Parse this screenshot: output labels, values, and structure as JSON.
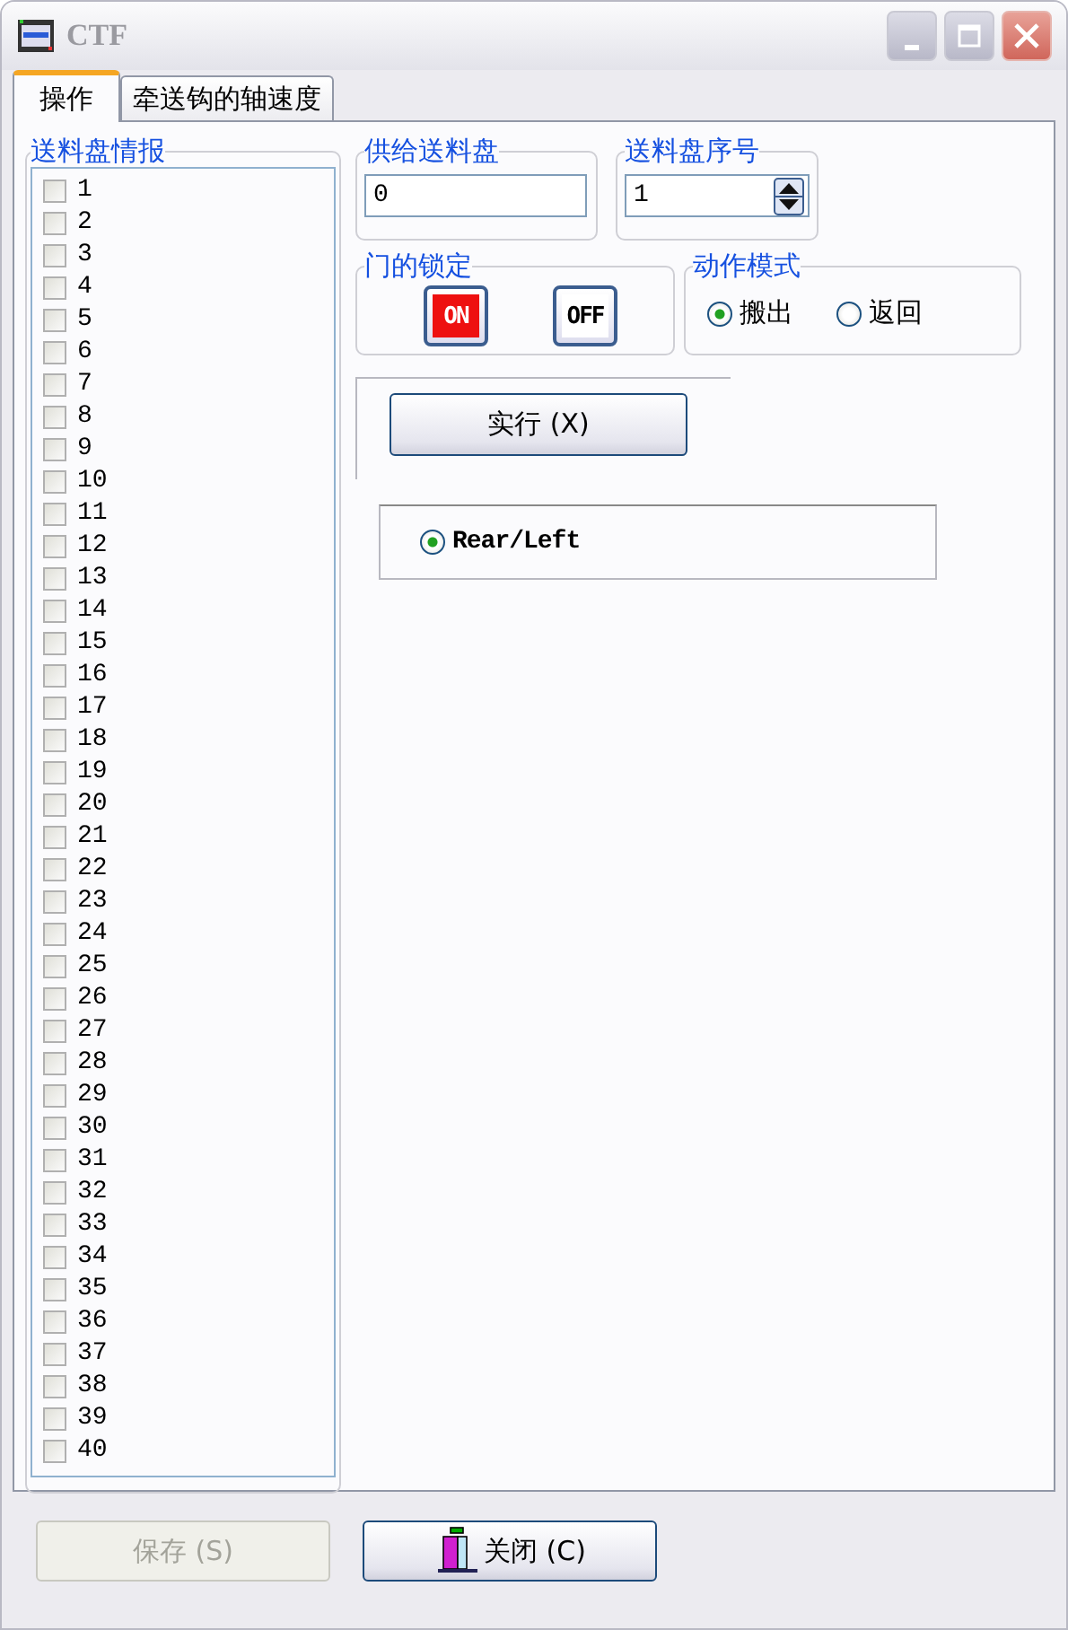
{
  "window": {
    "title": "CTF"
  },
  "tabs": [
    {
      "label": "操作",
      "selected": true
    },
    {
      "label": "牵送钩的轴速度",
      "selected": false
    }
  ],
  "tray_info": {
    "title": "送料盘情报",
    "items": [
      {
        "label": "1",
        "checked": false
      },
      {
        "label": "2",
        "checked": false
      },
      {
        "label": "3",
        "checked": false
      },
      {
        "label": "4",
        "checked": false
      },
      {
        "label": "5",
        "checked": false
      },
      {
        "label": "6",
        "checked": false
      },
      {
        "label": "7",
        "checked": false
      },
      {
        "label": "8",
        "checked": false
      },
      {
        "label": "9",
        "checked": false
      },
      {
        "label": "10",
        "checked": false
      },
      {
        "label": "11",
        "checked": false
      },
      {
        "label": "12",
        "checked": false
      },
      {
        "label": "13",
        "checked": false
      },
      {
        "label": "14",
        "checked": false
      },
      {
        "label": "15",
        "checked": false
      },
      {
        "label": "16",
        "checked": false
      },
      {
        "label": "17",
        "checked": false
      },
      {
        "label": "18",
        "checked": false
      },
      {
        "label": "19",
        "checked": false
      },
      {
        "label": "20",
        "checked": false
      },
      {
        "label": "21",
        "checked": false
      },
      {
        "label": "22",
        "checked": false
      },
      {
        "label": "23",
        "checked": false
      },
      {
        "label": "24",
        "checked": false
      },
      {
        "label": "25",
        "checked": false
      },
      {
        "label": "26",
        "checked": false
      },
      {
        "label": "27",
        "checked": false
      },
      {
        "label": "28",
        "checked": false
      },
      {
        "label": "29",
        "checked": false
      },
      {
        "label": "30",
        "checked": false
      },
      {
        "label": "31",
        "checked": false
      },
      {
        "label": "32",
        "checked": false
      },
      {
        "label": "33",
        "checked": false
      },
      {
        "label": "34",
        "checked": false
      },
      {
        "label": "35",
        "checked": false
      },
      {
        "label": "36",
        "checked": false
      },
      {
        "label": "37",
        "checked": false
      },
      {
        "label": "38",
        "checked": false
      },
      {
        "label": "39",
        "checked": false
      },
      {
        "label": "40",
        "checked": false
      }
    ]
  },
  "supply_tray": {
    "title": "供给送料盘",
    "value": "0"
  },
  "tray_number": {
    "title": "送料盘序号",
    "value": "1"
  },
  "door_lock": {
    "title": "门的锁定",
    "buttons": [
      {
        "label": "ON",
        "on": true
      },
      {
        "label": "OFF",
        "on": false
      }
    ]
  },
  "action_mode": {
    "title": "动作模式",
    "options": [
      {
        "label": "搬出",
        "selected": true
      },
      {
        "label": "返回",
        "selected": false
      }
    ]
  },
  "execute_button": {
    "label": "实行 (X)"
  },
  "position_options": [
    {
      "label": "Rear/Left",
      "selected": true
    }
  ],
  "buttons": [
    {
      "label": "保存 (S)",
      "kind": "plain",
      "disabled": true
    },
    {
      "label": "关闭 (C)",
      "kind": "door",
      "disabled": false
    }
  ]
}
